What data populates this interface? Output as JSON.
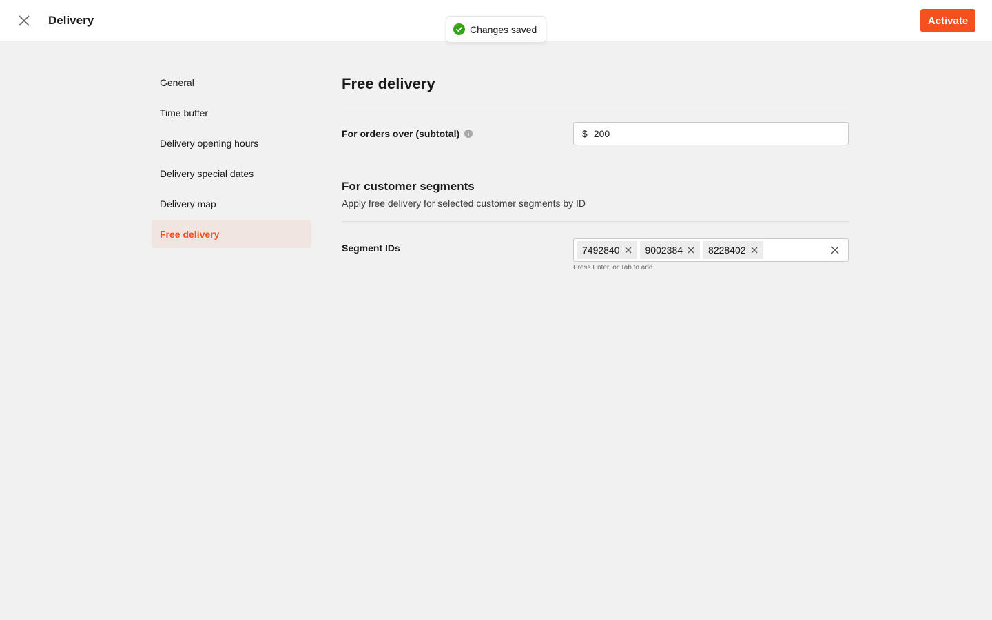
{
  "header": {
    "title": "Delivery",
    "close_icon": "close-icon",
    "activate_label": "Activate",
    "accent_color": "#f4511e"
  },
  "toast": {
    "icon": "check-circle-icon",
    "text": "Changes saved",
    "color": "#34a418"
  },
  "sidebar": {
    "items": [
      {
        "label": "General",
        "active": false
      },
      {
        "label": "Time buffer",
        "active": false
      },
      {
        "label": "Delivery opening hours",
        "active": false
      },
      {
        "label": "Delivery special dates",
        "active": false
      },
      {
        "label": "Delivery map",
        "active": false
      },
      {
        "label": "Free delivery",
        "active": true
      }
    ]
  },
  "main": {
    "title": "Free delivery",
    "orders_over": {
      "label": "For orders over (subtotal)",
      "icon": "info-icon",
      "prefix": "$",
      "value": "200"
    },
    "segments_section": {
      "title": "For customer segments",
      "description": "Apply free delivery for selected customer segments by ID"
    },
    "segment_ids": {
      "label": "Segment IDs",
      "tags": [
        "7492840",
        "9002384",
        "8228402"
      ],
      "hint": "Press Enter, or Tab to add"
    }
  }
}
